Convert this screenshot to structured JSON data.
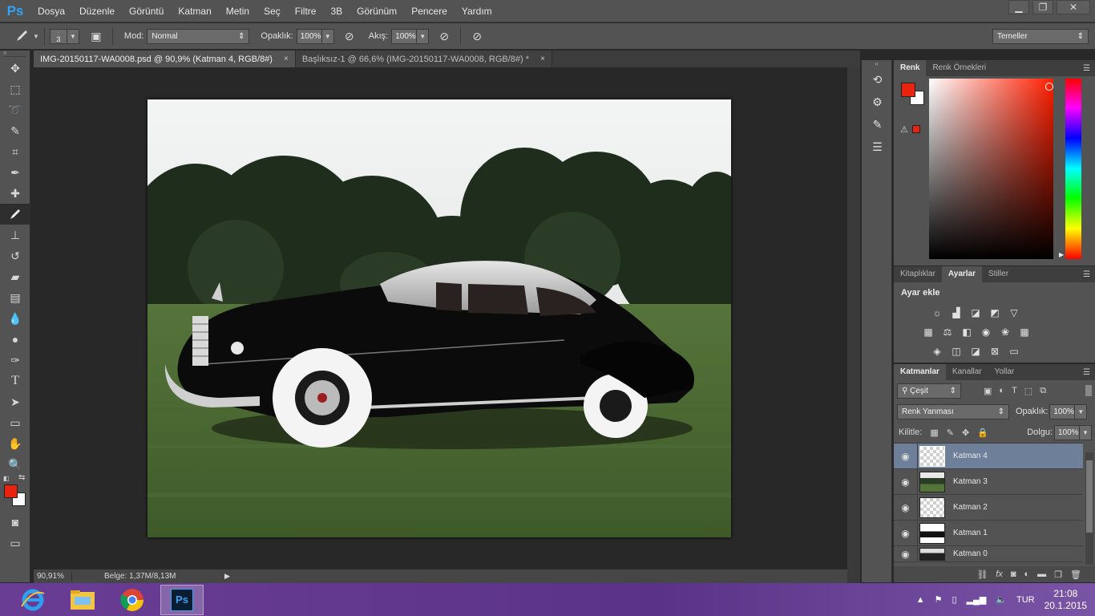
{
  "app": {
    "logo": "Ps"
  },
  "menu": [
    "Dosya",
    "Düzenle",
    "Görüntü",
    "Katman",
    "Metin",
    "Seç",
    "Filtre",
    "3B",
    "Görünüm",
    "Pencere",
    "Yardım"
  ],
  "window_controls": [
    "minimize-icon",
    "restore-icon",
    "close-icon"
  ],
  "options": {
    "brush_size": "3",
    "mode_label": "Mod:",
    "mode_value": "Normal",
    "opacity_label": "Opaklık:",
    "opacity_value": "100%",
    "flow_label": "Akış:",
    "flow_value": "100%",
    "workspace": "Temeller"
  },
  "tabs": [
    {
      "label": "IMG-20150117-WA0008.psd @ 90,9% (Katman 4, RGB/8#)",
      "close": "×"
    },
    {
      "label": "Başlıksız-1 @ 66,6% (IMG-20150117-WA0008, RGB/8#) *",
      "close": "×"
    }
  ],
  "status": {
    "zoom": "90,91%",
    "doc": "Belge: 1,37M/8,13M"
  },
  "color_panel": {
    "tabs": [
      "Renk",
      "Renk Örnekleri"
    ],
    "foreground": "#e8230f",
    "background": "#ffffff"
  },
  "adjust_panel": {
    "tabs": [
      "Kitaplıklar",
      "Ayarlar",
      "Stiller"
    ],
    "title": "Ayar ekle"
  },
  "layers_panel": {
    "tabs": [
      "Katmanlar",
      "Kanallar",
      "Yollar"
    ],
    "filter": "Çeşit",
    "blend_mode": "Renk Yanması",
    "opacity_label": "Opaklık:",
    "opacity_value": "100%",
    "lock_label": "Kilitle:",
    "fill_label": "Dolgu:",
    "fill_value": "100%",
    "layers": [
      {
        "name": "Katman 4"
      },
      {
        "name": "Katman 3"
      },
      {
        "name": "Katman 2"
      },
      {
        "name": "Katman 1"
      },
      {
        "name": "Katman 0"
      }
    ]
  },
  "taskbar": {
    "lang": "TUR",
    "time": "21:08",
    "date": "20.1.2015"
  }
}
